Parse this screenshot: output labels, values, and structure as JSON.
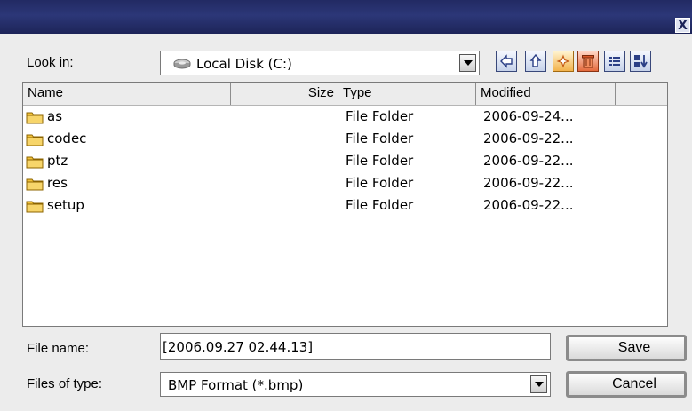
{
  "window": {
    "close_glyph": "X"
  },
  "lookin": {
    "label": "Look in:",
    "value": "Local Disk (C:)",
    "icon": "drive-icon"
  },
  "toolbar": {
    "icons": [
      "back-icon",
      "up-folder-icon",
      "new-folder-icon",
      "delete-icon",
      "list-view-icon",
      "sort-icon"
    ]
  },
  "file_list": {
    "columns": [
      "Name",
      "Size",
      "Type",
      "Modified",
      ""
    ],
    "rows": [
      {
        "name": "as",
        "size": "",
        "type": "File Folder",
        "modified": "2006-09-24..."
      },
      {
        "name": "codec",
        "size": "",
        "type": "File Folder",
        "modified": "2006-09-22..."
      },
      {
        "name": "ptz",
        "size": "",
        "type": "File Folder",
        "modified": "2006-09-22..."
      },
      {
        "name": "res",
        "size": "",
        "type": "File Folder",
        "modified": "2006-09-22..."
      },
      {
        "name": "setup",
        "size": "",
        "type": "File Folder",
        "modified": "2006-09-22..."
      }
    ]
  },
  "filename": {
    "label": "File name:",
    "value": "[2006.09.27 02.44.13]"
  },
  "filetype": {
    "label": "Files of type:",
    "value": "BMP Format (*.bmp)"
  },
  "buttons": {
    "save": "Save",
    "cancel": "Cancel"
  },
  "colors": {
    "titlebar": "#2c3778",
    "folder": "#f2c23a",
    "dialog_bg": "#ececec"
  }
}
